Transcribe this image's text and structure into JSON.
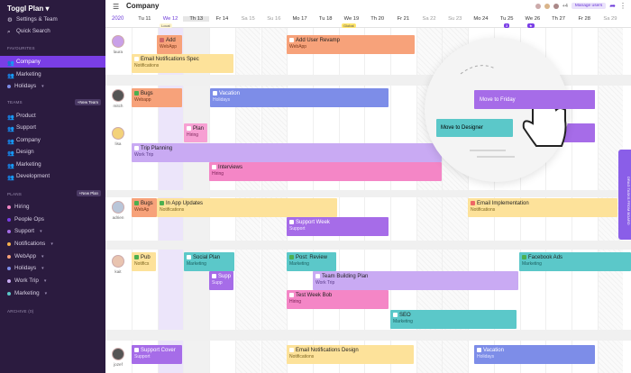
{
  "sidebar": {
    "workspace": "Toggl Plan",
    "top_items": [
      {
        "label": "Settings & Team",
        "icon": "gear-icon"
      },
      {
        "label": "Quick Search",
        "icon": "search-icon"
      }
    ],
    "favourites_label": "FAVOURITES",
    "favourites": [
      {
        "label": "Company",
        "icon": "people-icon",
        "active": true
      },
      {
        "label": "Marketing",
        "icon": "people-icon"
      },
      {
        "label": "Holidays",
        "icon": "dot-icon"
      }
    ],
    "teams_label": "TEAMS",
    "new_team": "+New Team",
    "teams": [
      "Product",
      "Support",
      "Company",
      "Design",
      "Marketing",
      "Development"
    ],
    "plans_label": "PLANS",
    "new_plan": "+New Plan",
    "plans": [
      {
        "label": "Hiring",
        "color": "#f486c6"
      },
      {
        "label": "People Ops",
        "color": "#7a3ee6"
      },
      {
        "label": "Support",
        "color": "#a66ce8"
      },
      {
        "label": "Notifications",
        "color": "#f7b24d"
      },
      {
        "label": "WebApp",
        "color": "#f7a27a"
      },
      {
        "label": "Holidays",
        "color": "#7d8de8"
      },
      {
        "label": "Work Trip",
        "color": "#c9aaf3"
      },
      {
        "label": "Marketing",
        "color": "#5bc8c9"
      }
    ],
    "archive_label": "ARCHIVE (0)"
  },
  "topbar": {
    "title": "Company",
    "extra_count": "+4",
    "manage_users": "Manage users"
  },
  "calendar": {
    "year": "2020",
    "days": [
      "Tu 11",
      "We 12",
      "Th 13",
      "Fr 14",
      "Sa 15",
      "Su 16",
      "Mo 17",
      "Tu 18",
      "We 19",
      "Th 20",
      "Fr 21",
      "Sa 22",
      "Su 23",
      "Mo 24",
      "Tu 25",
      "We 26",
      "Th 27",
      "Fr 28",
      "Sa 29"
    ],
    "local_tag": "Local",
    "global_tag": "Global",
    "tag_counts": [
      "3"
    ]
  },
  "people": [
    "laura",
    "mitch",
    "lisa",
    "adrien",
    "kait",
    "jozef"
  ],
  "tasks": [
    {
      "title": "Add",
      "plan": "WebApp",
      "color": "orange"
    },
    {
      "title": "Add User Revamp",
      "plan": "WebApp",
      "color": "orange"
    },
    {
      "title": "Email Notifications Spec",
      "plan": "Notifications",
      "color": "yellow"
    },
    {
      "title": "Bugs",
      "plan": "Webapp",
      "color": "orange"
    },
    {
      "title": "Vacation",
      "plan": "Holidays",
      "color": "blue"
    },
    {
      "title": "Move to Friday",
      "plan": "",
      "color": "violet"
    },
    {
      "title": "Plan",
      "plan": "Hiring",
      "color": "pink"
    },
    {
      "title": "Move to Designer",
      "plan": "",
      "color": "teal"
    },
    {
      "title": "Trip Planning",
      "plan": "Work Trip",
      "color": "purple"
    },
    {
      "title": "Interviews",
      "plan": "Hiring",
      "color": "hotpink"
    },
    {
      "title": "Bugs",
      "plan": "WebAp",
      "color": "orange"
    },
    {
      "title": "In App Updates",
      "plan": "Notifications",
      "color": "yellow"
    },
    {
      "title": "Email Implementation",
      "plan": "Notifications",
      "color": "yellow"
    },
    {
      "title": "Support Week",
      "plan": "Support",
      "color": "violet"
    },
    {
      "title": "Pub",
      "plan": "Notifics",
      "color": "yellow"
    },
    {
      "title": "Social Plan",
      "plan": "Marketing",
      "color": "teal"
    },
    {
      "title": "Post: Review",
      "plan": "Marketing",
      "color": "teal"
    },
    {
      "title": "Facebook Ads",
      "plan": "Marketing",
      "color": "teal"
    },
    {
      "title": "Supp",
      "plan": "Supp",
      "color": "violet"
    },
    {
      "title": "Team Building Plan",
      "plan": "Work Trip",
      "color": "purple"
    },
    {
      "title": "Test Week Bob",
      "plan": "Hiring",
      "color": "hotpink"
    },
    {
      "title": "SEO",
      "plan": "Marketing",
      "color": "teal"
    },
    {
      "title": "Support Cover",
      "plan": "Support",
      "color": "violet"
    },
    {
      "title": "Email Notifications Design",
      "plan": "Notifications",
      "color": "yellow"
    },
    {
      "title": "Vacation",
      "plan": "Holidays",
      "color": "blue"
    }
  ],
  "side_tab": "DRAG TASKS FROM BOARD"
}
